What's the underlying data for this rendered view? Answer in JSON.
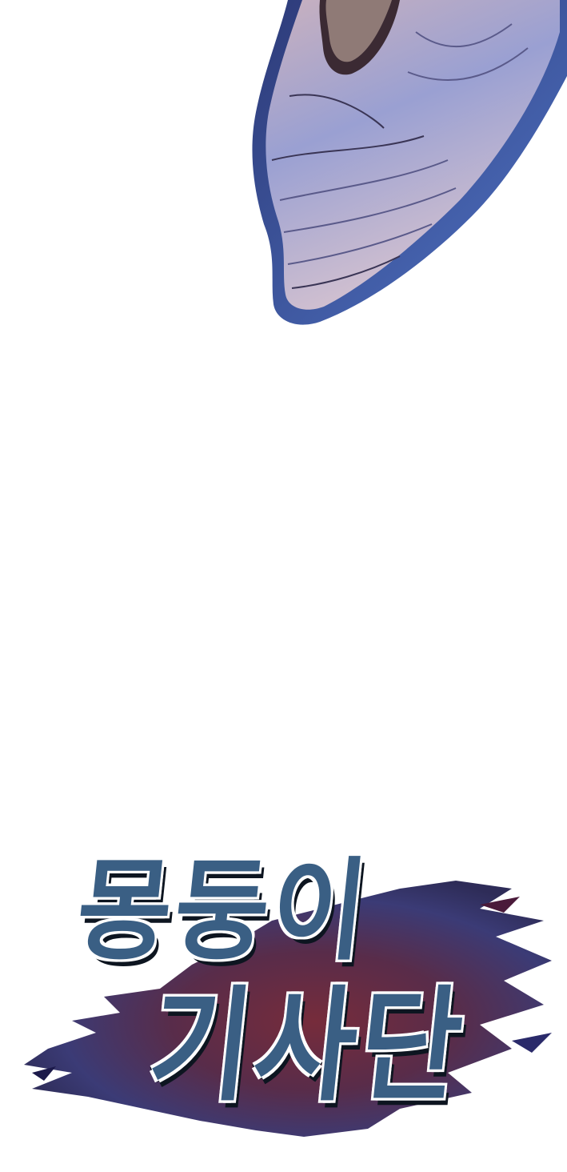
{
  "logo": {
    "title_line_1": "몽둥이",
    "title_line_2": "기사단",
    "text_color": "#3a5f84",
    "outline_color": "#0d1520",
    "splash_colors": [
      "#1c1a4a",
      "#4a1a3a",
      "#6a1a2a",
      "#2a2a6a"
    ]
  },
  "artwork": {
    "description_icon": "cloth-sleeve-illustration",
    "colors": [
      "#4f6fb8",
      "#8f98d0",
      "#c9b8c9",
      "#2a2f55"
    ]
  }
}
